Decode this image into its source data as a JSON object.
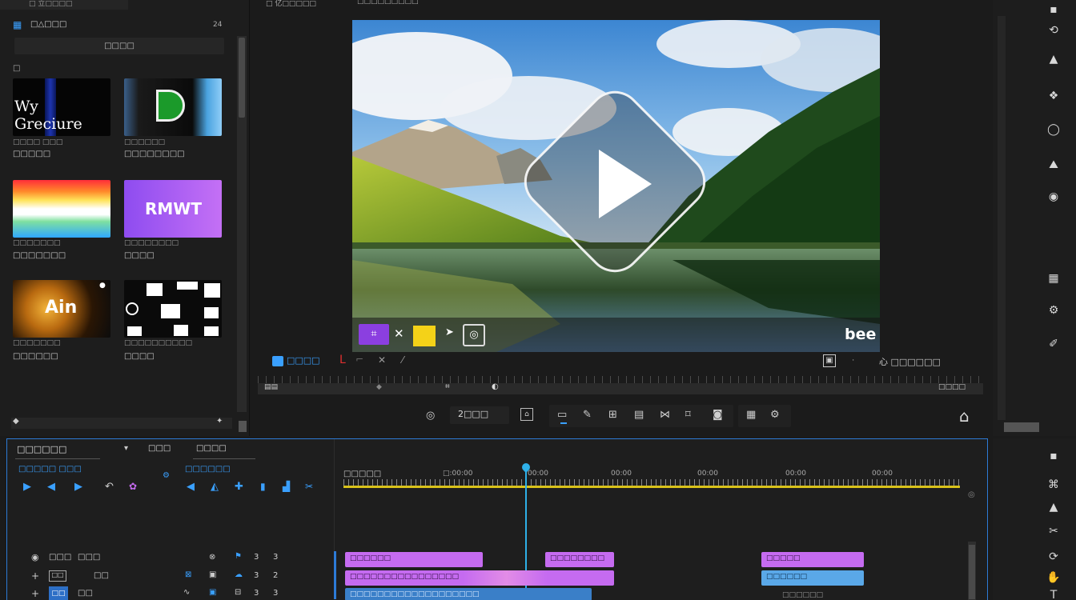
{
  "left_panel": {
    "top_bar_label": "□ 立□□□□",
    "header_title": "□△□□□",
    "header_right": "24",
    "search_button_label": "□□□□",
    "section_label": "□",
    "thumbnails": [
      {
        "text": "Wy Greciure",
        "caption1": "□□□□ □□□",
        "caption2": "□□□□□"
      },
      {
        "text": "",
        "caption1": "□□□□□□",
        "caption2": "□□□□□□□□"
      },
      {
        "text": "",
        "caption1": "□□□□□□□",
        "caption2": "□□□□□□□"
      },
      {
        "text": "RMWT",
        "caption1": "□□□□□□□□",
        "caption2": "□□□□"
      },
      {
        "text": "Ain",
        "caption1": "□□□□□□□",
        "caption2": "□□□□□□"
      },
      {
        "text": "",
        "caption1": "□□□□□□□□□□",
        "caption2": "□□□□"
      }
    ]
  },
  "monitor": {
    "tab1": "□ 亿□□□□□",
    "tab2": "□□□□□□□□□",
    "watermark": "bee",
    "status_left": "□□□□",
    "status_right": "心 □□□□□□",
    "ruler_right": "□□□□",
    "zoom_value": "2□□□",
    "accent": "#3aa0ff",
    "video_overlay_icons": [
      "purple-effect-icon",
      "close-icon",
      "yellow-grid-icon",
      "cursor-icon",
      "target-icon"
    ]
  },
  "timeline": {
    "title": "□□□□□□",
    "col_header2": "□□□",
    "col_header3": "□□□□",
    "sub_label1": "□□□□□ □□□",
    "sub_label2": "□□□□□□",
    "ruler_label": "□□□□□",
    "ruler_times": [
      "□:00:00",
      "00:00",
      "00:00",
      "00:00",
      "00:00",
      "00:00"
    ],
    "tracks": [
      {
        "label1": "□□□",
        "label2": "□□□",
        "num1": "3",
        "num2": "3"
      },
      {
        "label1": "□□",
        "label2": "□□",
        "num1": "3",
        "num2": "2"
      },
      {
        "label1": "□□",
        "label2": "□□",
        "num1": "3",
        "num2": "3"
      }
    ],
    "clips": {
      "c1": "□□□□□□",
      "c2": "□□□□□□□□",
      "c3": "□□□□□",
      "c4": "□□□□□□□□□□□□□□□□",
      "c5": "□□□□□□",
      "c6": "□□□□□□□□□□□□□□□□□□□",
      "c7": "□□□□□□"
    }
  }
}
